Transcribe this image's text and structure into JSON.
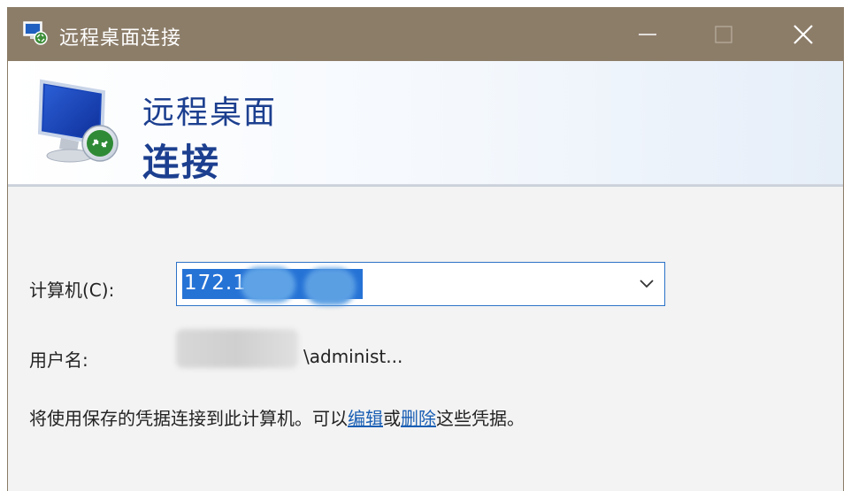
{
  "window": {
    "title": "远程桌面连接",
    "min_glyph": "—",
    "max_glyph": "☐",
    "close_glyph": "✕"
  },
  "banner": {
    "line1": "远程桌面",
    "line2": "连接"
  },
  "form": {
    "computer_label": "计算机(C):",
    "computer_value": "172.1",
    "username_label": "用户名:",
    "username_value": "\\administ..."
  },
  "note": {
    "prefix": "将使用保存的凭据连接到此计算机。可以",
    "edit_link": "编辑",
    "middle": "或",
    "delete_link": "删除",
    "suffix": "这些凭据。"
  },
  "colors": {
    "titlebar": "#8c7d69",
    "accent": "#2673d6",
    "banner_text": "#1c3f8f",
    "link": "#1a5fb4"
  }
}
